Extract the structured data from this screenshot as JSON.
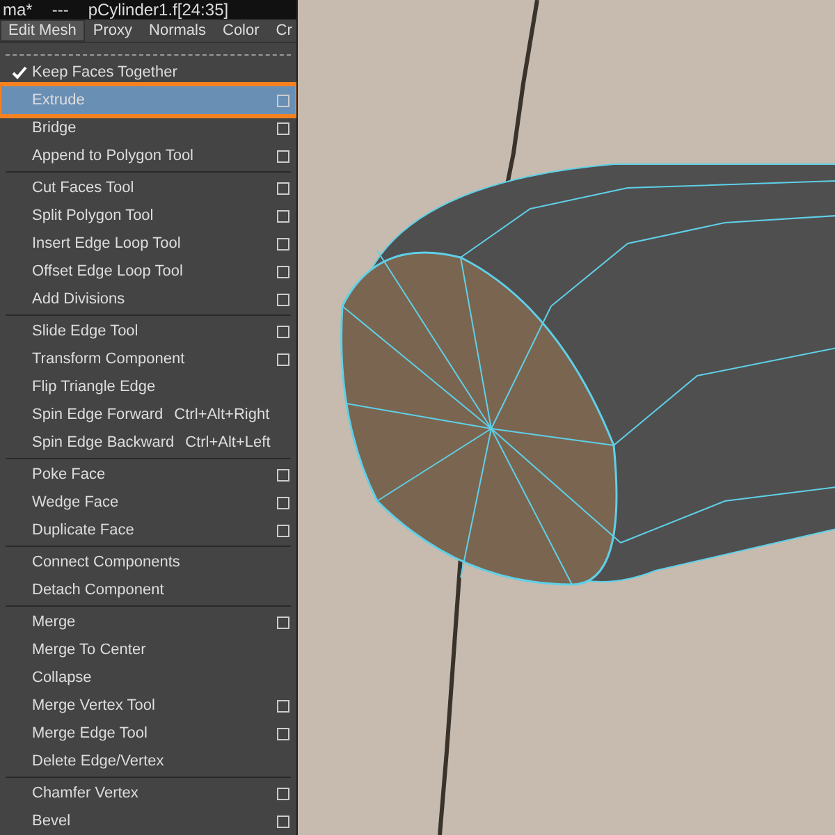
{
  "title_bar": {
    "scene": "ma*",
    "separator": "---",
    "selection": "pCylinder1.f[24:35]"
  },
  "menu_bar": [
    {
      "label": "Edit Mesh",
      "selected": true
    },
    {
      "label": "Proxy",
      "selected": false
    },
    {
      "label": "Normals",
      "selected": false
    },
    {
      "label": "Color",
      "selected": false
    },
    {
      "label": "Cr",
      "selected": false
    }
  ],
  "menu": [
    {
      "kind": "check",
      "label": "Keep Faces Together",
      "checked": true
    },
    {
      "kind": "item",
      "label": "Extrude",
      "option_box": true,
      "selected": true
    },
    {
      "kind": "item",
      "label": "Bridge",
      "option_box": true,
      "selected": false
    },
    {
      "kind": "item",
      "label": "Append to Polygon Tool",
      "option_box": true,
      "selected": false
    },
    {
      "kind": "separator"
    },
    {
      "kind": "item",
      "label": "Cut Faces Tool",
      "option_box": true,
      "selected": false
    },
    {
      "kind": "item",
      "label": "Split Polygon Tool",
      "option_box": true,
      "selected": false
    },
    {
      "kind": "item",
      "label": "Insert Edge Loop Tool",
      "option_box": true,
      "selected": false
    },
    {
      "kind": "item",
      "label": "Offset Edge Loop Tool",
      "option_box": true,
      "selected": false
    },
    {
      "kind": "item",
      "label": "Add Divisions",
      "option_box": true,
      "selected": false
    },
    {
      "kind": "separator"
    },
    {
      "kind": "item",
      "label": "Slide Edge Tool",
      "option_box": true,
      "selected": false
    },
    {
      "kind": "item",
      "label": "Transform Component",
      "option_box": true,
      "selected": false
    },
    {
      "kind": "item",
      "label": "Flip Triangle Edge",
      "option_box": false,
      "selected": false
    },
    {
      "kind": "item",
      "label": "Spin Edge Forward",
      "shortcut": "Ctrl+Alt+Right",
      "option_box": false,
      "selected": false
    },
    {
      "kind": "item",
      "label": "Spin Edge Backward",
      "shortcut": "Ctrl+Alt+Left",
      "option_box": false,
      "selected": false
    },
    {
      "kind": "separator"
    },
    {
      "kind": "item",
      "label": "Poke Face",
      "option_box": true,
      "selected": false
    },
    {
      "kind": "item",
      "label": "Wedge Face",
      "option_box": true,
      "selected": false
    },
    {
      "kind": "item",
      "label": "Duplicate Face",
      "option_box": true,
      "selected": false
    },
    {
      "kind": "separator"
    },
    {
      "kind": "item",
      "label": "Connect Components",
      "option_box": false,
      "selected": false
    },
    {
      "kind": "item",
      "label": "Detach Component",
      "option_box": false,
      "selected": false
    },
    {
      "kind": "separator"
    },
    {
      "kind": "item",
      "label": "Merge",
      "option_box": true,
      "selected": false
    },
    {
      "kind": "item",
      "label": "Merge To Center",
      "option_box": false,
      "selected": false
    },
    {
      "kind": "item",
      "label": "Collapse",
      "option_box": false,
      "selected": false
    },
    {
      "kind": "item",
      "label": "Merge Vertex Tool",
      "option_box": true,
      "selected": false
    },
    {
      "kind": "item",
      "label": "Merge Edge Tool",
      "option_box": true,
      "selected": false
    },
    {
      "kind": "item",
      "label": "Delete Edge/Vertex",
      "option_box": false,
      "selected": false
    },
    {
      "kind": "separator"
    },
    {
      "kind": "item",
      "label": "Chamfer Vertex",
      "option_box": true,
      "selected": false
    },
    {
      "kind": "item",
      "label": "Bevel",
      "option_box": true,
      "selected": false
    }
  ]
}
